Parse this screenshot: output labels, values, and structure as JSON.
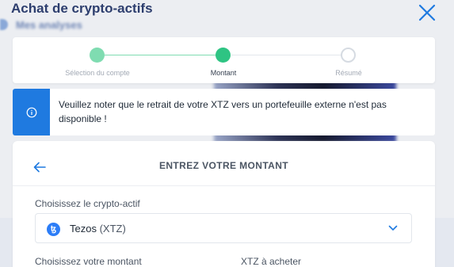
{
  "header": {
    "title": "Achat de crypto-actifs",
    "background_title": "Mes analyses"
  },
  "stepper": {
    "steps": [
      {
        "label": "Sélection du compte",
        "state": "completed"
      },
      {
        "label": "Montant",
        "state": "active"
      },
      {
        "label": "Résumé",
        "state": "upcoming"
      }
    ]
  },
  "notice": {
    "text": "Veuillez noter que le retrait de votre XTZ vers un portefeuille externe n'est pas disponible !"
  },
  "form": {
    "title": "ENTREZ VOTRE MONTANT",
    "crypto_label": "Choisissez le crypto-actif",
    "selected_asset_name": "Tezos",
    "selected_asset_ticker": "(XTZ)",
    "amount_label": "Choisissez votre montant",
    "to_buy_label": "XTZ à acheter"
  },
  "icons": {
    "close": "close-icon",
    "info": "info-icon",
    "back": "arrow-left-icon",
    "token": "tezos-icon",
    "dropdown": "chevron-down-icon"
  },
  "colors": {
    "accent_blue": "#1f7ae0",
    "step_completed": "#7fdcb1",
    "step_active": "#2ec483",
    "step_upcoming": "#d6dbe2",
    "header_text": "#2d3e6e",
    "tezos_blue": "#2c7df7"
  }
}
